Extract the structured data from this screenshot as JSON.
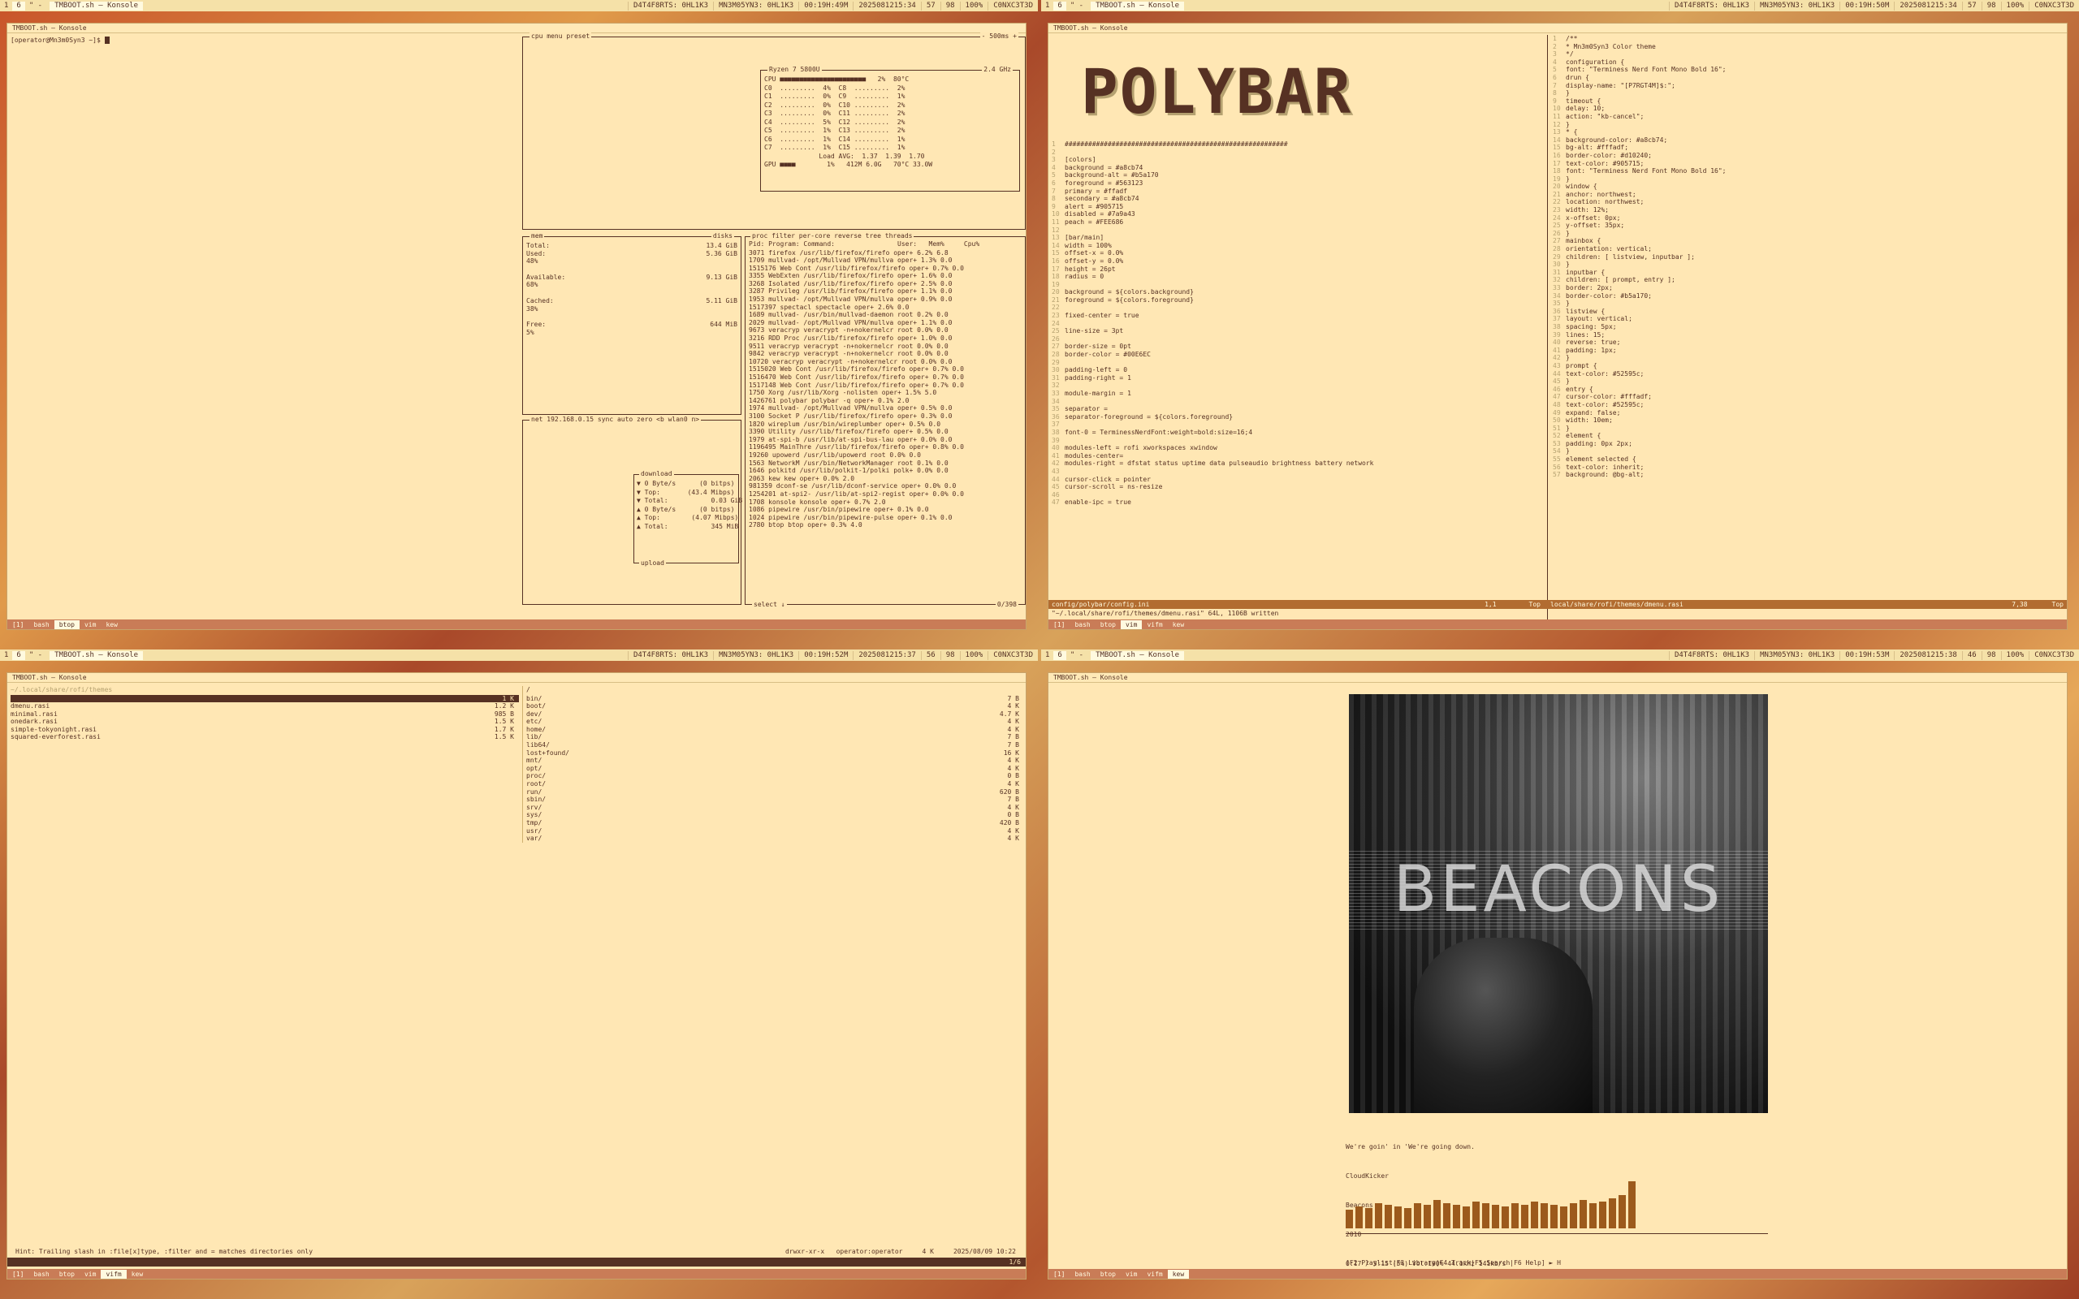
{
  "status": {
    "left_ws": [
      "1",
      "6"
    ],
    "wm": "\" -",
    "title": "TMBOOT.sh — Konsole",
    "right": [
      "D4T4F8RTS: 0HL1K3",
      "MN3M05YN3: 0HL1K3",
      "00:19H:49M",
      "2025081215:34",
      "57",
      "98",
      "100%",
      "C0NXC3T3D"
    ],
    "right_tr": [
      "D4T4F8RTS: 0HL1K3",
      "MN3M05YN3: 0HL1K3",
      "00:19H:50M",
      "2025081215:34",
      "57",
      "98",
      "100%",
      "C0NXC3T3D"
    ],
    "right_bl": [
      "D4T4F8RTS: 0HL1K3",
      "MN3M05YN3: 0HL1K3",
      "00:19H:52M",
      "2025081215:37",
      "56",
      "98",
      "100%",
      "C0NXC3T3D"
    ],
    "right_br": [
      "D4T4F8RTS: 0HL1K3",
      "MN3M05YN3: 0HL1K3",
      "00:19H:53M",
      "2025081215:38",
      "46",
      "98",
      "100%",
      "C0NXC3T3D"
    ]
  },
  "tabs": [
    "[1]",
    "bash",
    "btop",
    "vim",
    "vifm",
    "kew"
  ],
  "term_title": "TMBOOT.sh — Konsole",
  "tl": {
    "prompt": "[operator@Mn3m0Syn3 ~]$",
    "cpu_header": "cpu  menu  preset",
    "cpu_rate": "- 500ms +",
    "cpu_model": "Ryzen 7 5800U",
    "cpu_freq": "2.4 GHz",
    "cpu_rows": [
      "CPU ■■■■■■■■■■■■■■■■■■■■■■   2%  80°C",
      "C0  .........  4%  C8  .........  2%",
      "C1  .........  0%  C9  .........  1%",
      "C2  .........  0%  C10 .........  2%",
      "C3  .........  0%  C11 .........  2%",
      "C4  .........  5%  C12 .........  2%",
      "C5  .........  1%  C13 .........  2%",
      "C6  .........  1%  C14 .........  1%",
      "C7  .........  1%  C15 .........  1%",
      "              Load AVG:  1.37  1.39  1.70",
      "GPU ■■■■        1%   412M 6.0G   70°C 33.0W"
    ],
    "mem_header": "mem",
    "mem": [
      {
        "k": "Total:",
        "v": "13.4 GiB"
      },
      {
        "k": "Used:",
        "v": "5.36 GiB"
      },
      {
        "k": "48%",
        "v": ""
      },
      {
        "k": "Available:",
        "v": "9.13 GiB"
      },
      {
        "k": "68%",
        "v": ""
      },
      {
        "k": "Cached:",
        "v": "5.11 GiB"
      },
      {
        "k": "38%",
        "v": ""
      },
      {
        "k": "Free:",
        "v": "644 MiB"
      },
      {
        "k": "5%",
        "v": ""
      }
    ],
    "disks": "disks",
    "net_header": "net  192.168.0.15   sync auto zero  <b wlan0 n>",
    "download": "download",
    "upload": "upload",
    "net": [
      "▼ 0 Byte/s      (0 bitps)",
      "▼ Top:       (43.4 Mibps)",
      "▼ Total:           0.03 GiB",
      "",
      "▲ 0 Byte/s      (0 bitps)",
      "▲ Top:        (4.07 Mibps)",
      "▲ Total:           345 MiB"
    ],
    "proc_header": "proc  filter  per-core reverse tree  threads",
    "proc_cols": "Pid: Program: Command:                User:   Mem%     Cpu%",
    "procs": [
      "3071 firefox  /usr/lib/firefox/firefo oper+  6.2%     6.8",
      "1709 mullvad- /opt/Mullvad VPN/mullva oper+  1.3%     0.0",
      "1515176 Web Cont /usr/lib/firefox/firefo oper+  0.7%   0.0",
      "3355 WebExten /usr/lib/firefox/firefo oper+  1.6%     0.0",
      "3268 Isolated /usr/lib/firefox/firefo oper+  2.5%     0.0",
      "3287 Privileg /usr/lib/firefox/firefo oper+  1.1%     0.0",
      "1953 mullvad- /opt/Mullvad VPN/mullva oper+  0.9%     0.0",
      "1517397 spectacl spectacle          oper+  2.6%   0.0",
      "1689 mullvad- /usr/bin/mullvad-daemon root  0.2%     0.0",
      "2029 mullvad- /opt/Mullvad VPN/mullva oper+  1.1%     0.0",
      "9673 veracryp veracrypt -n+nokernelcr root  0.0%     0.0",
      "3216 RDD Proc /usr/lib/firefox/firefo oper+  1.0%     0.0",
      "9511 veracryp veracrypt -n+nokernelcr root  0.0%     0.0",
      "9842 veracryp veracrypt -n+nokernelcr root  0.0%     0.0",
      "10720 veracryp veracrypt -n+nokernelcr root  0.0%    0.0",
      "1515020 Web Cont /usr/lib/firefox/firefo oper+  0.7%   0.0",
      "1516470 Web Cont /usr/lib/firefox/firefo oper+  0.7%   0.0",
      "1517148 Web Cont /usr/lib/firefox/firefo oper+  0.7%   0.0",
      "1750 Xorg     /usr/lib/Xorg -nolisten oper+  1.5%     5.0",
      "1426761 polybar  polybar -q         oper+  0.1%   2.0",
      "1974 mullvad- /opt/Mullvad VPN/mullva oper+  0.5%     0.0",
      "3100 Socket P /usr/lib/firefox/firefo oper+  0.3%     0.0",
      "1820 wireplum /usr/bin/wireplumber  oper+  0.5%     0.0",
      "3390 Utility  /usr/lib/firefox/firefo oper+  0.5%     0.0",
      "1979 at-spi-b /usr/lib/at-spi-bus-lau oper+  0.0%     0.0",
      "1196495 MainThre /usr/lib/firefox/firefo oper+  0.8%   0.0",
      "19260 upowerd  /usr/lib/upowerd     root   0.0%    0.0",
      "1563 NetworkM /usr/bin/NetworkManager root  0.1%     0.0",
      "1646 polkitd  /usr/lib/polkit-1/polki polk+  0.0%     0.0",
      "2063 kew      kew                   oper+  0.0%     2.0",
      "981359 dconf-se /usr/lib/dconf-service oper+  0.0%   0.0",
      "1254201 at-spi2- /usr/lib/at-spi2-regist oper+  0.0%   0.0",
      "1708 konsole  konsole               oper+  0.7%     2.0",
      "1086 pipewire /usr/bin/pipewire     oper+  0.1%     0.0",
      "1024 pipewire /usr/bin/pipewire-pulse oper+  0.1%   0.0",
      "2780 btop     btop                  oper+  0.3%     4.0"
    ],
    "proc_footer": "select ↓",
    "proc_count": "0/398"
  },
  "tr": {
    "logo": "POLYBAR",
    "left_lines": [
      "#########################################################",
      "",
      "[colors]",
      "background = #a8cb74",
      "background-alt = #b5a170",
      "foreground = #563123",
      "primary = #ffadf",
      "secondary = #a8cb74",
      "alert = #905715",
      "disabled = #7a9a43",
      "peach = #FEE686",
      "",
      "[bar/main]",
      "width = 100%",
      "offset-x = 0.0%",
      "offset-y = 0.0%",
      "height = 26pt",
      "radius = 0",
      "",
      "background = ${colors.background}",
      "foreground = ${colors.foreground}",
      "",
      "fixed-center = true",
      "",
      "line-size = 3pt",
      "",
      "border-size = 0pt",
      "border-color = #00E6EC",
      "",
      "padding-left = 0",
      "padding-right = 1",
      "",
      "module-margin = 1",
      "",
      "separator = ",
      "separator-foreground = ${colors.foreground}",
      "",
      "font-0 = TerminessNerdFont:weight=bold:size=16;4",
      "",
      "modules-left = rofi xworkspaces xwindow",
      "modules-center=",
      "modules-right = dfstat status uptime data pulseaudio brightness battery network",
      "",
      "cursor-click = pointer",
      "cursor-scroll = ns-resize",
      "",
      "enable-ipc = true"
    ],
    "right_lines": [
      "/**",
      " * Mn3m0Syn3 Color theme",
      " */",
      "configuration {",
      "  font: \"Terminess Nerd Font Mono Bold 16\";",
      "  drun {",
      "    display-name: \"[P7RGT4M]$:\";",
      "  }",
      "  timeout {",
      "    delay: 10;",
      "    action: \"kb-cancel\";",
      "  }",
      "* {",
      "    background-color:         #a8cb74;",
      "    bg-alt:                   #fffadf;",
      "    border-color:             #d10240;",
      "    text-color:               #905715;",
      "    font:                     \"Terminess Nerd Font Mono Bold 16\";",
      "}",
      "window {",
      "    anchor:      northwest;",
      "    location:    northwest;",
      "    width:       12%;",
      "    x-offset:    0px;",
      "    y-offset:    35px;",
      "}",
      "mainbox {",
      "    orientation: vertical;",
      "    children:  [ listview, inputbar ];",
      "}",
      "inputbar {",
      "    children: [ prompt, entry ];",
      "    border:     2px;",
      "    border-color: #b5a170;",
      "}",
      "listview {",
      "    layout:     vertical;",
      "    spacing:    5px;",
      "    lines:      15;",
      "    reverse:    true;",
      "    padding:    1px;",
      "}",
      "prompt {",
      "    text-color: #52595c;",
      "}",
      "entry {",
      "    cursor-color: #fffadf;",
      "    text-color: #52595c;",
      "    expand:     false;",
      "    width:      10em;",
      "}",
      "element {",
      "    padding:  0px 2px;",
      "}",
      "element selected {",
      "    text-color:    inherit;",
      "    background:    @bg-alt;"
    ],
    "status_left": "config/polybar/config.ini",
    "status_pos": "1,1",
    "status_top": "Top",
    "status_right": "local/share/rofi/themes/dmenu.rasi",
    "status_pos2": "7,38",
    "status_top2": "Top",
    "cmd": "\"~/.local/share/rofi/themes/dmenu.rasi\" 64L, 1106B written"
  },
  "bl": {
    "path": "~/.local/share/rofi/themes",
    "files": [
      {
        "n": "",
        "s": "1 K"
      },
      {
        "n": "dmenu.rasi",
        "s": "1.2 K"
      },
      {
        "n": "minimal.rasi",
        "s": "985 B"
      },
      {
        "n": "onedark.rasi",
        "s": "1.5 K"
      },
      {
        "n": "simple-tokyonight.rasi",
        "s": "1.7 K"
      },
      {
        "n": "squared-everforest.rasi",
        "s": "1.5 K"
      }
    ],
    "root_path": "/",
    "dirs": [
      {
        "n": "bin/",
        "s": "7 B"
      },
      {
        "n": "boot/",
        "s": "4 K"
      },
      {
        "n": "dev/",
        "s": "4.7 K"
      },
      {
        "n": "etc/",
        "s": "4 K"
      },
      {
        "n": "home/",
        "s": "4 K"
      },
      {
        "n": "lib/",
        "s": "7 B"
      },
      {
        "n": "lib64/",
        "s": "7 B"
      },
      {
        "n": "lost+found/",
        "s": "16 K"
      },
      {
        "n": "mnt/",
        "s": "4 K"
      },
      {
        "n": "opt/",
        "s": "4 K"
      },
      {
        "n": "proc/",
        "s": "0 B"
      },
      {
        "n": "root/",
        "s": "4 K"
      },
      {
        "n": "run/",
        "s": "620 B"
      },
      {
        "n": "sbin/",
        "s": "7 B"
      },
      {
        "n": "srv/",
        "s": "4 K"
      },
      {
        "n": "sys/",
        "s": "0 B"
      },
      {
        "n": "tmp/",
        "s": "420 B"
      },
      {
        "n": "usr/",
        "s": "4 K"
      },
      {
        "n": "var/",
        "s": "4 K"
      }
    ],
    "hint": "Hint: Trailing slash in :file[x]type, :filter and = matches directories only",
    "perm": "drwxr-xr-x   operator:operator",
    "size": "4 K",
    "date": "2025/08/09 10:22",
    "count": "1/6"
  },
  "br": {
    "album_text": "BEACONS",
    "track": "We're goin' in 'We're going down.",
    "artist": "CloudKicker",
    "album": "Beacons",
    "year": "2010",
    "progress": "0:17 / 5:15 (5%) Vol:100% 44.1kHz 141kb/s",
    "vis": [
      22,
      26,
      24,
      30,
      28,
      26,
      24,
      30,
      28,
      34,
      30,
      28,
      26,
      32,
      30,
      28,
      26,
      30,
      28,
      32,
      30,
      28,
      26,
      30,
      34,
      30,
      32,
      36,
      40,
      56
    ],
    "menu": "[F2 Playlist|F3 Library|F4 Track|F5 Search|F6 Help] ► H"
  }
}
